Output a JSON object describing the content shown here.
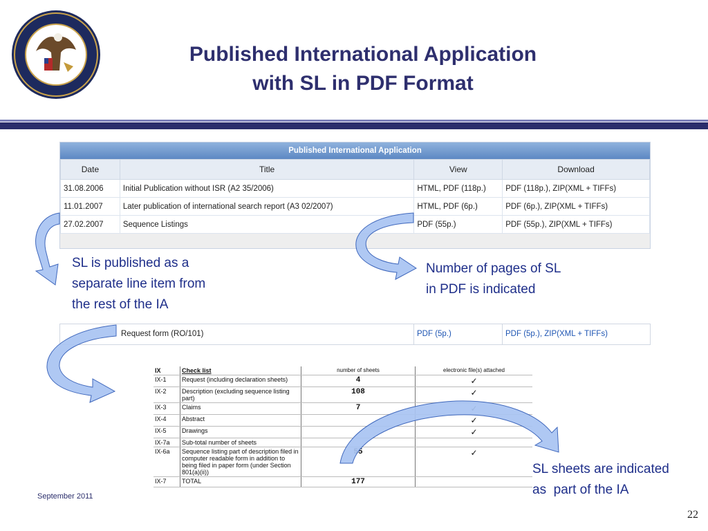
{
  "slide": {
    "title_line1": "Published International Application",
    "title_line2": "with SL in PDF Format",
    "seal_text": "UNITED STATES PATENT AND TRADEMARK OFFICE · DEPARTMENT OF COMMERCE",
    "footer_date": "September 2011",
    "page_number": "22",
    "colors": {
      "title": "#2e2f6e",
      "rule": "#2a2d6b",
      "callout": "#1f2f8a",
      "arrow": "#a9c4f2"
    }
  },
  "pia_table": {
    "heading": "Published International Application",
    "columns": [
      "Date",
      "Title",
      "View",
      "Download"
    ],
    "rows": [
      {
        "date": "31.08.2006",
        "title": "Initial Publication without ISR (A2 35/2006)",
        "view": "HTML, PDF (118p.)",
        "download": "PDF (118p.), ZIP(XML + TIFFs)"
      },
      {
        "date": "11.01.2007",
        "title": "Later publication of international search report (A3 02/2007)",
        "view": "HTML, PDF (6p.)",
        "download": "PDF (6p.), ZIP(XML + TIFFs)"
      },
      {
        "date": "27.02.2007",
        "title": "Sequence Listings",
        "view": "PDF (55p.)",
        "download": "PDF (55p.), ZIP(XML + TIFFs)"
      }
    ]
  },
  "request_form_row": {
    "title": "Request form (RO/101)",
    "view": "PDF (5p.)",
    "download": "PDF (5p.), ZIP(XML + TIFFs)"
  },
  "checklist": {
    "headers": [
      "IX",
      "Check list",
      "number of sheets",
      "electronic file(s) attached"
    ],
    "rows": [
      {
        "code": "IX-1",
        "item": "Request (including declaration sheets)",
        "sheets": "4",
        "attached": "✓"
      },
      {
        "code": "IX-2",
        "item": "Description (excluding sequence listing part)",
        "sheets": "108",
        "attached": "✓"
      },
      {
        "code": "IX-3",
        "item": "Claims",
        "sheets": "7",
        "attached": "✓"
      },
      {
        "code": "IX-4",
        "item": "Abstract",
        "sheets": "",
        "attached": "✓"
      },
      {
        "code": "IX-5",
        "item": "Drawings",
        "sheets": "",
        "attached": "✓"
      },
      {
        "code": "IX-7a",
        "item": "Sub-total number of sheets",
        "sheets": "",
        "attached": ""
      },
      {
        "code": "IX-6a",
        "item": "Sequence listing part of description filed in computer readable form in addition to being filed in paper form (under Section 801(a)(ii))",
        "sheets": "55",
        "attached": "✓"
      },
      {
        "code": "IX-7",
        "item": "TOTAL",
        "sheets": "177",
        "attached": ""
      }
    ]
  },
  "callouts": {
    "left_line1": "SL is published as a",
    "left_line2": "separate line item from",
    "left_line3": "the rest of the IA",
    "right_line1": "Number of pages of SL",
    "right_line2": "in PDF is indicated",
    "bottom_line1": "SL sheets are indicated",
    "bottom_line2": "as  part of the IA"
  }
}
